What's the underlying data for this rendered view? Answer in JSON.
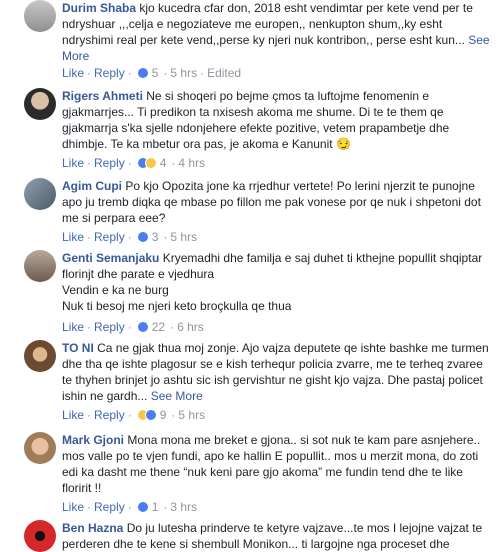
{
  "comments": [
    {
      "author": "Durim Shaba",
      "text": "kjo kucedra cfar don, 2018 esht vendimtar per kete vend per te ndryshuar ,,,celja e negoziateve me europen,, nenkupton shum,,ky esht ndryshimi real per kete vend,,perse ky njeri nuk kontribon,, perse esht kun... ",
      "see_more": "See More",
      "like": "Like",
      "reply": "Reply",
      "reaction_count": "5",
      "time": "5 hrs",
      "edited": "Edited",
      "reactions": [
        "like-icon"
      ]
    },
    {
      "author": "Rigers Ahmeti",
      "text": "Ne si shoqeri po bejme çmos ta luftojme fenomenin e gjakmarrjes... Ti predikon ta nxisesh akoma me shume. Di te te them qe gjakmarrja s'ka sjelle ndonjehere efekte pozitive, vetem prapambetje dhe dhimbje. Te ka mbetur ora pas, je akoma e Kanunit ",
      "emoji": "😏",
      "like": "Like",
      "reply": "Reply",
      "reaction_count": "4",
      "time": "4 hrs",
      "reactions": [
        "like-icon",
        "haha-icon"
      ]
    },
    {
      "author": "Agim Cupi",
      "text": "Po kjo Opozita jone ka rrjedhur vertete! Po lerini njerzit te punojne apo ju tremb diqka qe mbase po fillon me pak vonese por qe nuk i shpetoni dot me si perpara eee?",
      "like": "Like",
      "reply": "Reply",
      "reaction_count": "3",
      "time": "5 hrs",
      "reactions": [
        "like-icon"
      ]
    },
    {
      "author": "Genti Semanjaku",
      "text": "Kryemadhi dhe familja e saj duhet ti kthejne popullit shqiptar florinjt dhe parate e vjedhura",
      "text2": "Vendin e ka ne burg",
      "text3": "Nuk ti besoj me njeri keto broçkulla qe thua",
      "like": "Like",
      "reply": "Reply",
      "reaction_count": "22",
      "time": "6 hrs",
      "reactions": [
        "like-icon"
      ]
    },
    {
      "author": "TO NI",
      "text": "Ca ne gjak thua moj zonje. Ajo vajza deputete qe ishte bashke me turmen dhe tha qe ishte plagosur se e kish terhequr policia zvarre, me te terheq zvaree te thyhen brinjet jo ashtu sic ish gervishtur ne gisht kjo vajza. Dhe pastaj policet ishin ne gardh... ",
      "see_more": "See More",
      "like": "Like",
      "reply": "Reply",
      "reaction_count": "9",
      "time": "5 hrs",
      "reactions": [
        "haha-icon",
        "like-icon"
      ]
    },
    {
      "author": "Mark Gjoni",
      "text": "Mona mona me breket e gjona.. si sot nuk te kam pare asnjehere.. mos valle po te vjen fundi, apo ke hallin E popullit.. mos u merzit mona, do zoti edi ka dasht me thene “nuk keni pare gjo akoma” me fundin tend dhe te like floririt !!",
      "like": "Like",
      "reply": "Reply",
      "reaction_count": "1",
      "time": "3 hrs",
      "reactions": [
        "like-icon"
      ]
    },
    {
      "author": "Ben Hazna",
      "text": "Do ju lutesha prinderve te ketyre vajzave...te mos I lejojne vajzat te perderen dhe te kene si shembull Monikon... ti largojne nga proceset dhe",
      "reactions": []
    }
  ],
  "colors": {
    "author": "#385898",
    "action_link": "#4267b2",
    "meta": "#90949c",
    "like_reaction": "#4a7ef0",
    "haha_reaction": "#f7c94b"
  }
}
